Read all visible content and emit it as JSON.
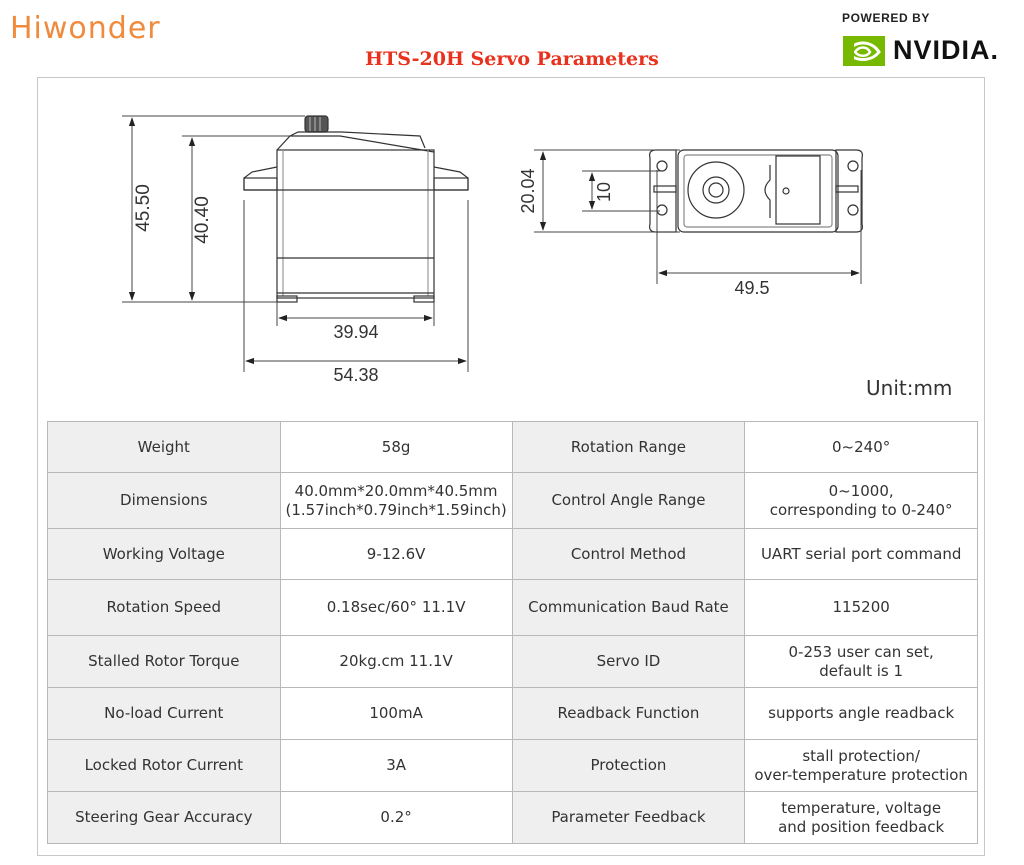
{
  "header": {
    "brand": "Hiwonder",
    "title": "HTS-20H Servo Parameters",
    "powered_by": "POWERED BY",
    "partner": "NVIDIA."
  },
  "drawing": {
    "side_view": {
      "total_height": "45.50",
      "body_height": "40.40",
      "body_width": "39.94",
      "total_width": "54.38"
    },
    "top_view": {
      "width": "20.04",
      "hole_spacing": "10",
      "mount_spacing": "49.5"
    },
    "unit": "Unit:mm"
  },
  "specs": {
    "rows": [
      {
        "label_left": "Weight",
        "value_left": [
          "58g"
        ],
        "label_right": "Rotation Range",
        "value_right": [
          "0~240°"
        ]
      },
      {
        "label_left": "Dimensions",
        "value_left": [
          "40.0mm*20.0mm*40.5mm",
          "(1.57inch*0.79inch*1.59inch)"
        ],
        "label_right": "Control Angle Range",
        "value_right": [
          "0~1000,",
          "corresponding to 0-240°"
        ]
      },
      {
        "label_left": "Working Voltage",
        "value_left": [
          "9-12.6V"
        ],
        "label_right": "Control Method",
        "value_right": [
          "UART serial port command"
        ]
      },
      {
        "label_left": "Rotation Speed",
        "value_left": [
          "0.18sec/60° 11.1V"
        ],
        "label_right": "Communication Baud Rate",
        "value_right": [
          "115200"
        ]
      },
      {
        "label_left": "Stalled Rotor Torque",
        "value_left": [
          "20kg.cm 11.1V"
        ],
        "label_right": "Servo ID",
        "value_right": [
          "0-253 user can set,",
          "default is 1"
        ]
      },
      {
        "label_left": "No-load Current",
        "value_left": [
          "100mA"
        ],
        "label_right": "Readback Function",
        "value_right": [
          "supports angle readback"
        ]
      },
      {
        "label_left": "Locked Rotor Current",
        "value_left": [
          "3A"
        ],
        "label_right": "Protection",
        "value_right": [
          "stall protection/",
          "over-temperature protection"
        ]
      },
      {
        "label_left": "Steering Gear Accuracy",
        "value_left": [
          "0.2°"
        ],
        "label_right": "Parameter Feedback",
        "value_right": [
          "temperature, voltage",
          "and position feedback"
        ]
      }
    ]
  },
  "colors": {
    "brand": "#f08a3c",
    "title": "#e8321e",
    "nvidia_green": "#76b900",
    "label_bg": "#efefef",
    "border": "#b8b8b8"
  }
}
